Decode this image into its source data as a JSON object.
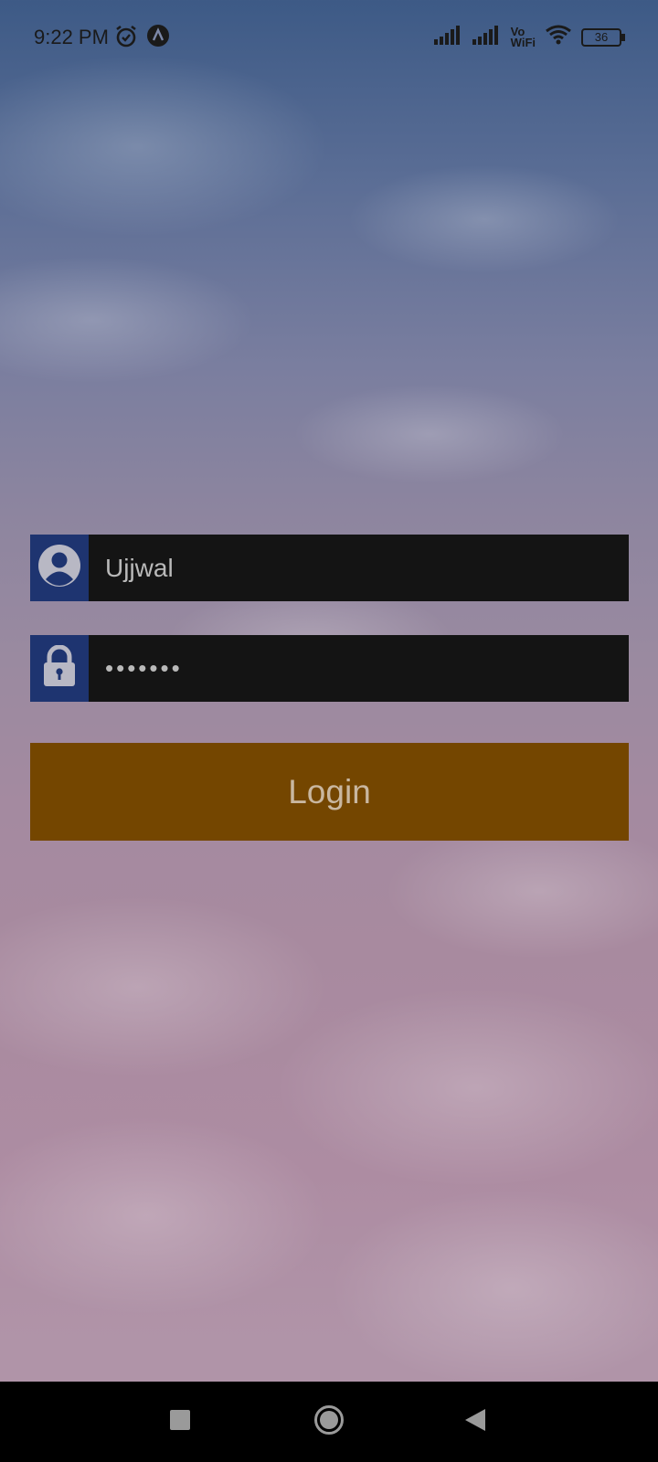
{
  "status_bar": {
    "time": "9:22 PM",
    "icons": [
      "alarm-icon",
      "app-notification-icon",
      "signal-icon",
      "signal-icon",
      "vowifi-icon",
      "wifi-icon",
      "battery-icon"
    ],
    "vowifi_top": "Vo",
    "vowifi_bottom": "WiFi",
    "battery": "36"
  },
  "login_form": {
    "username": {
      "value": "Ujjwal",
      "icon": "user-icon"
    },
    "password": {
      "value": "•••••••",
      "icon": "lock-icon"
    },
    "login_button_label": "Login"
  },
  "nav_bar": {
    "icons": [
      "recent-apps-icon",
      "home-icon",
      "back-icon"
    ]
  },
  "colors": {
    "field_bg": "#141414",
    "icon_box_bg": "#1e3470",
    "button_bg": "#744600",
    "button_text": "#c9b7a0"
  }
}
